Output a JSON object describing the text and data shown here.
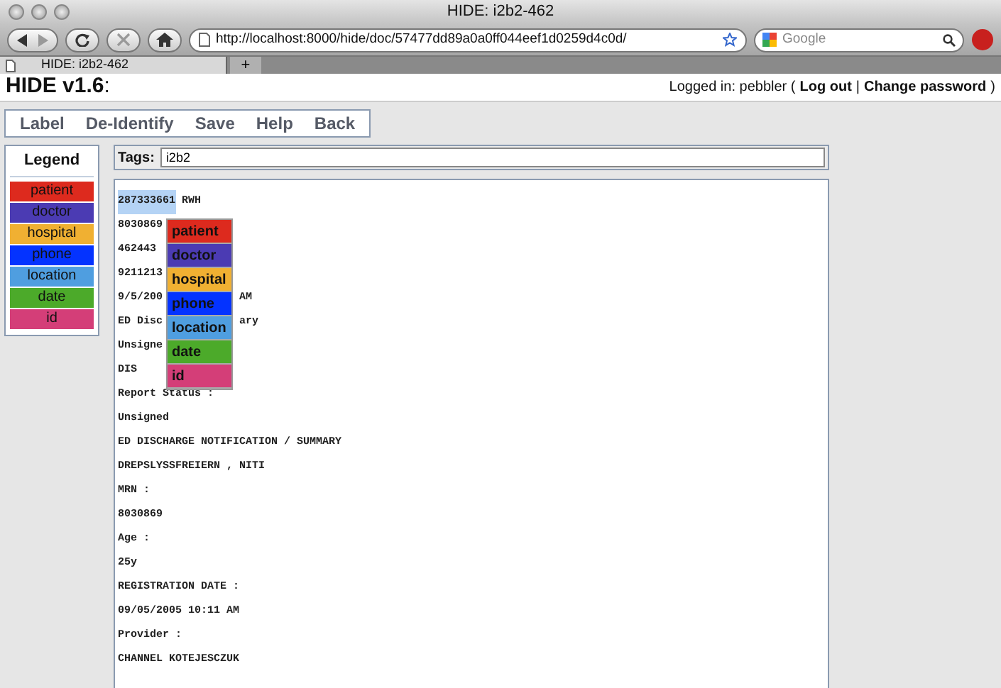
{
  "browser": {
    "title": "HIDE: i2b2-462",
    "url": "http://localhost:8000/hide/doc/57477dd89a0a0ff044eef1d0259d4c0d/",
    "search_placeholder": "Google",
    "tabs": [
      {
        "label": "HIDE: i2b2-462",
        "selected": true
      }
    ],
    "new_tab": "+"
  },
  "header": {
    "title": "**HIDE v1.6**:",
    "login": "Logged in: pebbler (",
    "links": [
      "Log out",
      "Change password"
    ],
    "separator": "|",
    "login_end": ")"
  },
  "menu": [
    "Label",
    "De-Identify",
    "Save",
    "Help",
    "Back"
  ],
  "legend": {
    "title": "Legend",
    "items": [
      {
        "label": "patient",
        "color": "#dd2a1e"
      },
      {
        "label": "doctor",
        "color": "#4b3bb3"
      },
      {
        "label": "hospital",
        "color": "#f0b032"
      },
      {
        "label": "phone",
        "color": "#0433ff"
      },
      {
        "label": "location",
        "color": "#4f9ee0"
      },
      {
        "label": "date",
        "color": "#4caa2a"
      },
      {
        "label": "id",
        "color": "#d43e78"
      }
    ]
  },
  "tags": {
    "label": "Tags:",
    "value": "i2b2"
  },
  "document": {
    "lines": [
      {
        "text": "287333661",
        "highlighted": true,
        "after": "RWH"
      },
      {
        "text": "8030869",
        "highlighted": false
      },
      {
        "text": "462443",
        "highlighted": false
      },
      {
        "text": "9211213",
        "highlighted": false
      },
      {
        "text": "9/5/200",
        "highlighted": false,
        "right_of_menu": "AM"
      },
      {
        "text": "ED Disc",
        "highlighted": false,
        "right_of_menu": "ary"
      },
      {
        "text": "Unsigne",
        "highlighted": false
      },
      {
        "text": "DIS",
        "highlighted": false
      },
      {
        "text": "Report Status :",
        "highlighted": false
      },
      {
        "text": "Unsigned",
        "highlighted": false
      },
      {
        "text": "ED DISCHARGE NOTIFICATION / SUMMARY",
        "highlighted": false
      },
      {
        "text": "DREPSLYSSFREIERN , NITI",
        "highlighted": false
      },
      {
        "text": "MRN :",
        "highlighted": false
      },
      {
        "text": "8030869",
        "highlighted": false
      },
      {
        "text": "Age :",
        "highlighted": false
      },
      {
        "text": "25y",
        "highlighted": false
      },
      {
        "text": "REGISTRATION DATE :",
        "highlighted": false
      },
      {
        "text": "09/05/2005 10:11 AM",
        "highlighted": false
      },
      {
        "text": "Provider :",
        "highlighted": false
      },
      {
        "text": "CHANNEL KOTEJESCZUK",
        "highlighted": false
      }
    ]
  },
  "popup_menu": {
    "items": [
      {
        "label": "patient",
        "color": "#dd2a1e"
      },
      {
        "label": "doctor",
        "color": "#4b3bb3"
      },
      {
        "label": "hospital",
        "color": "#f0b032"
      },
      {
        "label": "phone",
        "color": "#0433ff"
      },
      {
        "label": "location",
        "color": "#4f9ee0"
      },
      {
        "label": "date",
        "color": "#4caa2a"
      },
      {
        "label": "id",
        "color": "#d43e78"
      }
    ]
  }
}
